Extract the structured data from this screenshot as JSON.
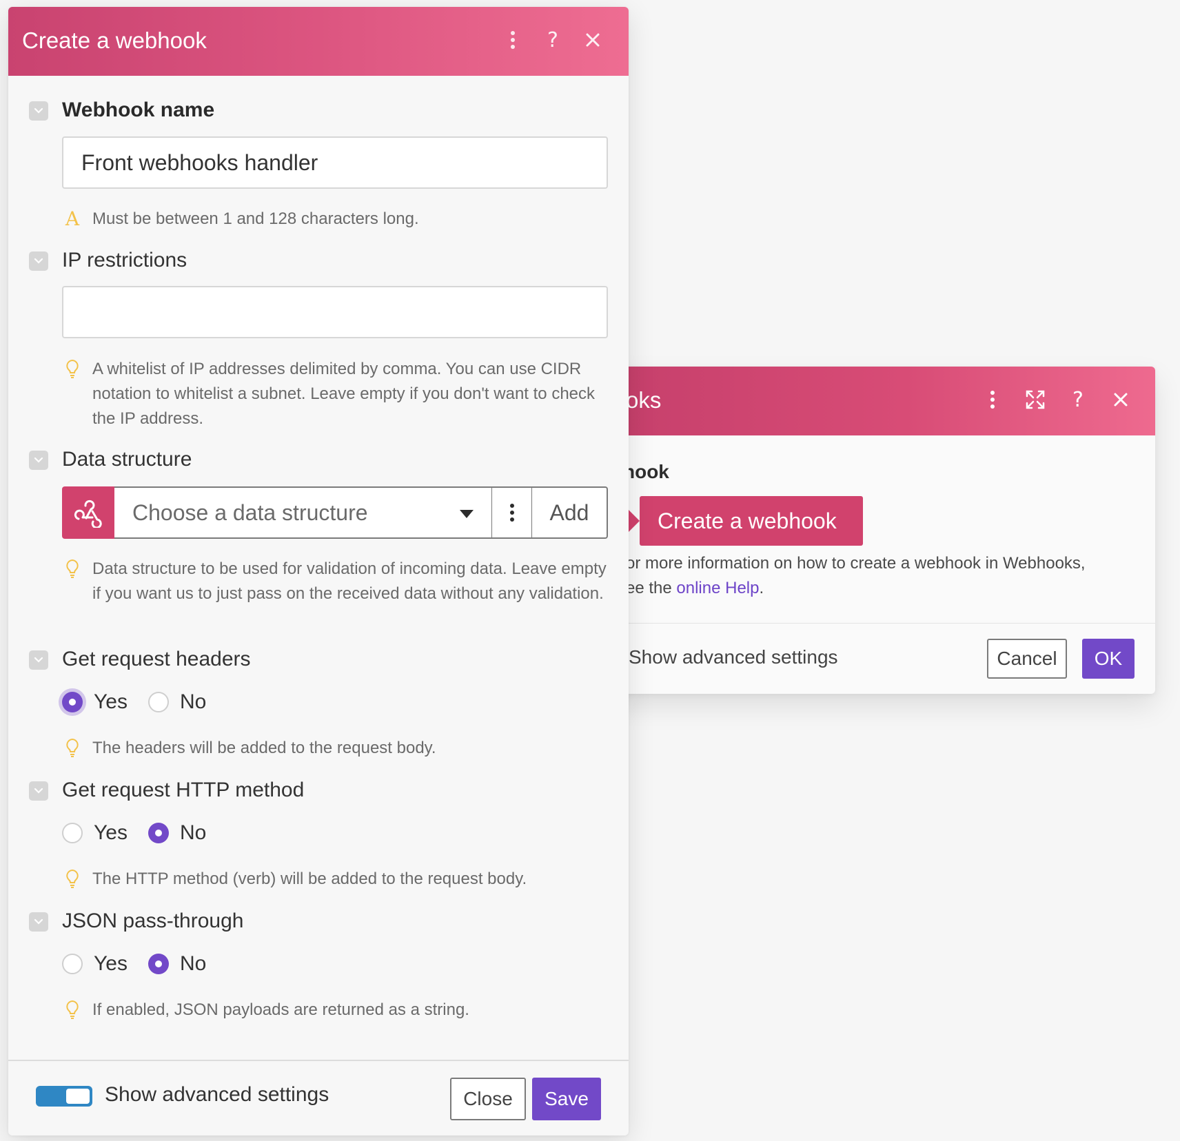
{
  "background_dialog": {
    "title": "oks",
    "section_label": "hook",
    "create_button": "Create a webhook",
    "help_text": "or more information on how to create a webhook in Webhooks,",
    "help_text_2_prefix": "ee the ",
    "help_link": "online Help",
    "help_text_2_suffix": ".",
    "advanced_label": "Show advanced settings",
    "cancel_label": "Cancel",
    "ok_label": "OK"
  },
  "dialog": {
    "title": "Create a webhook",
    "fields": {
      "webhook_name": {
        "label": "Webhook name",
        "value": "Front webhooks handler",
        "hint": "Must be between 1 and 128 characters long."
      },
      "ip_restrictions": {
        "label": "IP restrictions",
        "value": "",
        "hint": "A whitelist of IP addresses delimited by comma. You can use CIDR notation to whitelist a subnet. Leave empty if you don't want to check the IP address."
      },
      "data_structure": {
        "label": "Data structure",
        "placeholder": "Choose a data structure",
        "add_label": "Add",
        "hint": "Data structure to be used for validation of incoming data. Leave empty if you want us to just pass on the received data without any validation."
      },
      "request_headers": {
        "label": "Get request headers",
        "yes": "Yes",
        "no": "No",
        "selected": "Yes",
        "hint": "The headers will be added to the request body."
      },
      "http_method": {
        "label": "Get request HTTP method",
        "yes": "Yes",
        "no": "No",
        "selected": "No",
        "hint": "The HTTP method (verb) will be added to the request body."
      },
      "json_passthrough": {
        "label": "JSON pass-through",
        "yes": "Yes",
        "no": "No",
        "selected": "No",
        "hint": "If enabled, JSON payloads are returned as a string."
      }
    },
    "footer": {
      "advanced_label": "Show advanced settings",
      "advanced_on": true,
      "close_label": "Close",
      "save_label": "Save"
    }
  },
  "colors": {
    "header_pink": "#d84c76",
    "accent_purple": "#7249c8",
    "toggle_blue": "#2f87c4",
    "hint_yellow": "#f3c24a"
  },
  "icons": [
    "more-vertical-icon",
    "help-icon",
    "close-icon",
    "expand-icon",
    "collapse-chevron-icon",
    "warning-icon",
    "lightbulb-icon",
    "webhook-icon",
    "caret-down-icon"
  ]
}
